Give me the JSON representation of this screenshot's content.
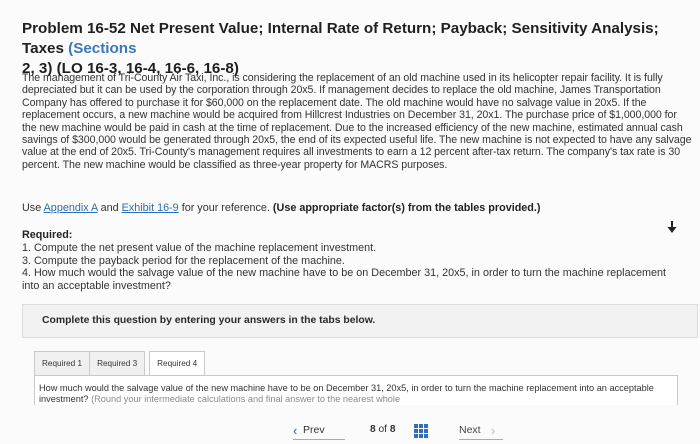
{
  "problem": {
    "title_main": "Problem 16-52 Net Present Value; Internal Rate of Return; Payback; Sensitivity Analysis; Taxes ",
    "title_sections": "(Sections",
    "title_line2": "2, 3) (LO 16-3, 16-4, 16-6, 16-8)"
  },
  "paragraph": "The management of Tri-County Air Taxi, Inc., is considering the replacement of an old machine used in its helicopter repair facility. It is fully depreciated but it can be used by the corporation through 20x5. If management decides to replace the old machine, James Transportation Company has offered to purchase it for $60,000 on the replacement date. The old machine would have no salvage value in 20x5. If the replacement occurs, a new machine would be acquired from Hillcrest Industries on December 31, 20x1. The purchase price of $1,000,000 for the new machine would be paid in cash at the time of replacement. Due to the increased efficiency of the new machine, estimated annual cash savings of $300,000 would be generated through 20x5, the end of its expected useful life. The new machine is not expected to have any salvage value at the end of 20x5. Tri-County's management requires all investments to earn a 12 percent after-tax return. The company's tax rate is 30 percent. The new machine would be classified as three-year property for MACRS purposes.",
  "reference": {
    "prefix": "Use ",
    "link1": "Appendix A",
    "middle": " and ",
    "link2": "Exhibit 16-9",
    "suffix": " for your reference. ",
    "bold_note": "(Use appropriate factor(s) from the tables provided.)"
  },
  "required": {
    "heading": "Required:",
    "items": [
      "1. Compute the net present value of the machine replacement investment.",
      "3. Compute the payback period for the replacement of the machine.",
      "4. How much would the salvage value of the new machine have to be on December 31, 20x5, in order to turn the machine replacement into an acceptable investment?"
    ]
  },
  "instruction": "Complete this question by entering your answers in the tabs below.",
  "tabs": [
    "Required 1",
    "Required 3",
    "Required 4"
  ],
  "question": {
    "text": "How much would the salvage value of the new machine have to be on December 31, 20x5, in order to turn the machine replacement into an acceptable investment? ",
    "hint": "(Round your intermediate calculations and final answer to the nearest whole"
  },
  "nav": {
    "prev": "Prev",
    "counter_current": "8",
    "counter_of": "of",
    "counter_total": "8",
    "next": "Next"
  },
  "colors": {
    "accent_blue": "#2f6fb5",
    "sections_blue": "#3a78b8"
  }
}
